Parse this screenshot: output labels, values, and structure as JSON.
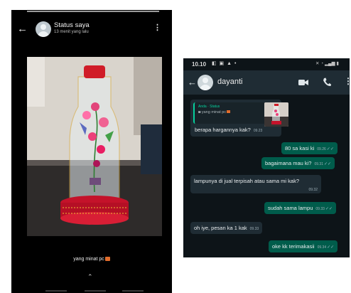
{
  "status_view": {
    "name": "Status saya",
    "time_ago": "13 menit yang lalu",
    "caption": "yang minat pc",
    "caption_emoji": "emoji",
    "menu_icon": "more-vertical-icon",
    "back_icon": "back-arrow-icon"
  },
  "chat": {
    "system_time": "10.10",
    "contact_name": "dayanti",
    "quoted": {
      "from": "Anda · Status",
      "text": "yang minat pc",
      "reply": "berapa hargannya kak?",
      "time": "09.23"
    },
    "messages": [
      {
        "direction": "out",
        "text": "80 sa kasi ki",
        "time": "09.26"
      },
      {
        "direction": "out",
        "text": "bagaimana mau ki?",
        "time": "09.31"
      },
      {
        "direction": "in",
        "text": "lampunya di jual terpisah atau sama mi kak?",
        "time": "09.32"
      },
      {
        "direction": "out",
        "text": "sudah sama lampu",
        "time": "09.33"
      },
      {
        "direction": "in",
        "text": "oh iye, pesan ka 1 kak",
        "time": "09.33"
      },
      {
        "direction": "out",
        "text": "oke kk terimakasii",
        "time": "09.34"
      }
    ],
    "ticks": "✓✓",
    "colors": {
      "incoming": "#1f2c34",
      "outgoing": "#005c4b",
      "background": "#0d1418",
      "accent": "#06cf9c"
    }
  }
}
